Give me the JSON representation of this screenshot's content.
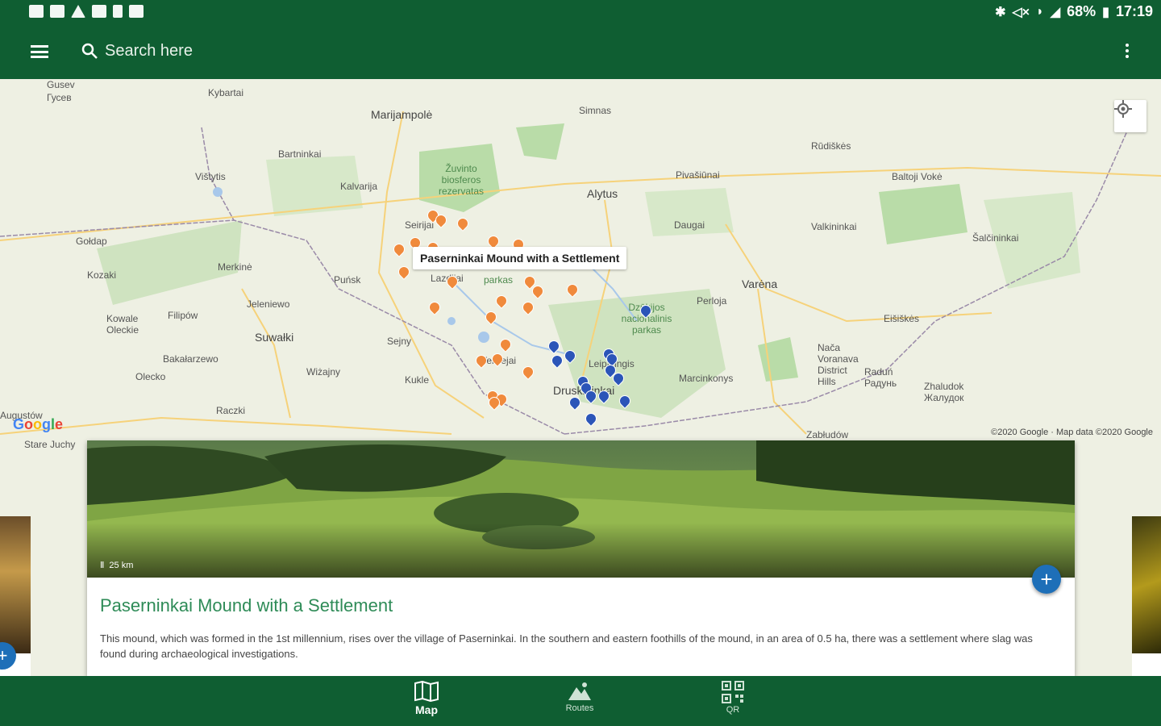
{
  "status_bar": {
    "left_icons": [
      "mail-icon",
      "image-icon",
      "warning-icon",
      "photo-icon",
      "sd-card-icon",
      "gallery-icon"
    ],
    "right_icons": [
      "bluetooth-icon",
      "mute-icon",
      "wifi-icon",
      "signal-icon",
      "battery-icon"
    ],
    "battery": "68%",
    "time": "17:19"
  },
  "app_bar": {
    "search_placeholder": "Search here"
  },
  "map": {
    "tooltip": "Paserninkai Mound with a Settlement",
    "labels": [
      {
        "text": "Marijampolė",
        "cls": "big"
      },
      {
        "text": "Kybartai",
        "cls": ""
      },
      {
        "text": "Gusev",
        "cls": ""
      },
      {
        "text": "Гусев",
        "cls": ""
      },
      {
        "text": "Bartninkai",
        "cls": ""
      },
      {
        "text": "Vištytis",
        "cls": ""
      },
      {
        "text": "Kalvarija",
        "cls": ""
      },
      {
        "text": "Žuvinto biosferos rezervatas",
        "cls": "park"
      },
      {
        "text": "Alytus",
        "cls": "big"
      },
      {
        "text": "Simnas",
        "cls": ""
      },
      {
        "text": "Rūdiškės",
        "cls": ""
      },
      {
        "text": "Pivašiūnai",
        "cls": ""
      },
      {
        "text": "Baltoji Vokė",
        "cls": ""
      },
      {
        "text": "Seirijai",
        "cls": ""
      },
      {
        "text": "Daugai",
        "cls": ""
      },
      {
        "text": "Valkininkai",
        "cls": ""
      },
      {
        "text": "Šalčininkai",
        "cls": ""
      },
      {
        "text": "Gołdap",
        "cls": ""
      },
      {
        "text": "Merkinė",
        "cls": ""
      },
      {
        "text": "Puńsk",
        "cls": ""
      },
      {
        "text": "Lazdijai",
        "cls": ""
      },
      {
        "text": "parkas",
        "cls": "park"
      },
      {
        "text": "Varėna",
        "cls": "big"
      },
      {
        "text": "Perloja",
        "cls": ""
      },
      {
        "text": "Kozaki",
        "cls": ""
      },
      {
        "text": "Jeleniewo",
        "cls": ""
      },
      {
        "text": "Filipów",
        "cls": ""
      },
      {
        "text": "Kowale Oleckie",
        "cls": ""
      },
      {
        "text": "Suwałki",
        "cls": "big"
      },
      {
        "text": "Sejny",
        "cls": ""
      },
      {
        "text": "Dzūkijos nacionalinis parkas",
        "cls": "park"
      },
      {
        "text": "Eišiškės",
        "cls": ""
      },
      {
        "text": "Bakałarzewo",
        "cls": ""
      },
      {
        "text": "Veisiejai",
        "cls": ""
      },
      {
        "text": "Leipalingis",
        "cls": ""
      },
      {
        "text": "Marcinkonys",
        "cls": ""
      },
      {
        "text": "Nača Voranava District Hills",
        "cls": ""
      },
      {
        "text": "Raduń Радунь",
        "cls": ""
      },
      {
        "text": "Zhaludok Жалудок",
        "cls": ""
      },
      {
        "text": "Olecko",
        "cls": ""
      },
      {
        "text": "Wiżajny",
        "cls": ""
      },
      {
        "text": "Kukle",
        "cls": ""
      },
      {
        "text": "Druskininkai",
        "cls": "big"
      },
      {
        "text": "Raczki",
        "cls": ""
      },
      {
        "text": "Augustów",
        "cls": ""
      },
      {
        "text": "Zabłudów",
        "cls": ""
      },
      {
        "text": "Stare Juchy",
        "cls": ""
      }
    ],
    "copyright": "©2020 Google · Map data ©2020 Google",
    "google_logo": [
      "G",
      "o",
      "o",
      "g",
      "l",
      "e"
    ]
  },
  "card": {
    "distance": "25 km",
    "title": "Paserninkai Mound with a Settlement",
    "description": "This mound, which was formed in the 1st millennium, rises over the village of Paserninkai. In the southern and eastern foothills of the mound, in an area of 0.5 ha, there was a settlement where slag was found during archaeological investigations."
  },
  "bottom_nav": [
    {
      "label": "Map",
      "icon": "map-icon"
    },
    {
      "label": "Routes",
      "icon": "routes-icon"
    },
    {
      "label": "QR",
      "icon": "qr-icon"
    }
  ],
  "colors": {
    "primary": "#0f5e32",
    "title_green": "#2e8b57",
    "fab_blue": "#1e6fb8",
    "pin_orange": "#f08a3c",
    "pin_blue": "#2b55b8"
  }
}
